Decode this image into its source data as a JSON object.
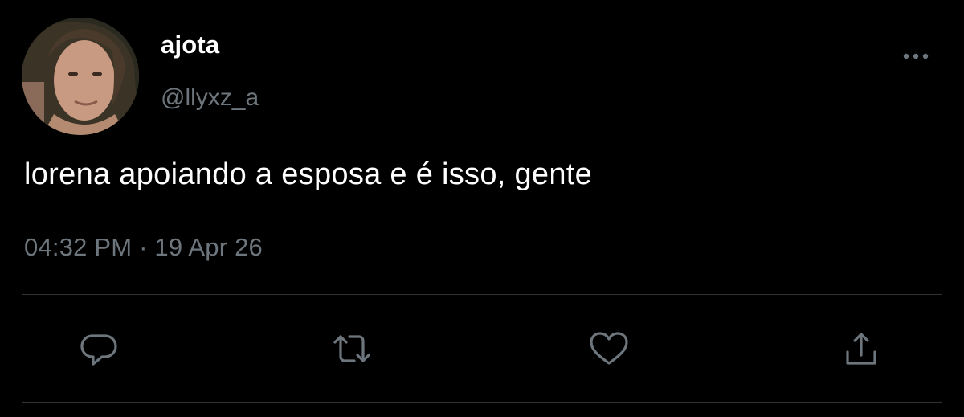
{
  "tweet": {
    "display_name": "ajota",
    "handle": "@llyxz_a",
    "text": "lorena apoiando a esposa e é isso, gente",
    "timestamp": "04:32 PM · 19 Apr 26"
  },
  "icons": {
    "more": "more-horizontal-icon",
    "reply": "reply-icon",
    "retweet": "retweet-icon",
    "like": "heart-icon",
    "share": "share-icon"
  },
  "colors": {
    "background": "#000000",
    "primary_text": "#ffffff",
    "secondary_text": "#6e767d",
    "divider": "#2f3336"
  }
}
